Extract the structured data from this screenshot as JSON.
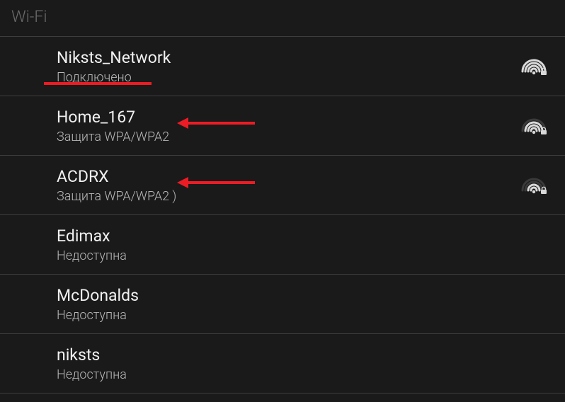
{
  "header": {
    "title": "Wi-Fi"
  },
  "networks": [
    {
      "ssid": "Niksts_Network",
      "status": "Подключено",
      "signal": 4,
      "locked": true,
      "underline": true,
      "arrow": false
    },
    {
      "ssid": "Home_167",
      "status": "Защита WPA/WPA2",
      "signal": 3,
      "locked": true,
      "underline": false,
      "arrow": true
    },
    {
      "ssid": "ACDRX",
      "status": "Защита WPA/WPA2 )",
      "signal": 2,
      "locked": true,
      "underline": false,
      "arrow": true
    },
    {
      "ssid": "Edimax",
      "status": "Недоступна",
      "signal": 0,
      "locked": false,
      "underline": false,
      "arrow": false
    },
    {
      "ssid": "McDonalds",
      "status": "Недоступна",
      "signal": 0,
      "locked": false,
      "underline": false,
      "arrow": false
    },
    {
      "ssid": "niksts",
      "status": "Недоступна",
      "signal": 0,
      "locked": false,
      "underline": false,
      "arrow": false
    }
  ]
}
